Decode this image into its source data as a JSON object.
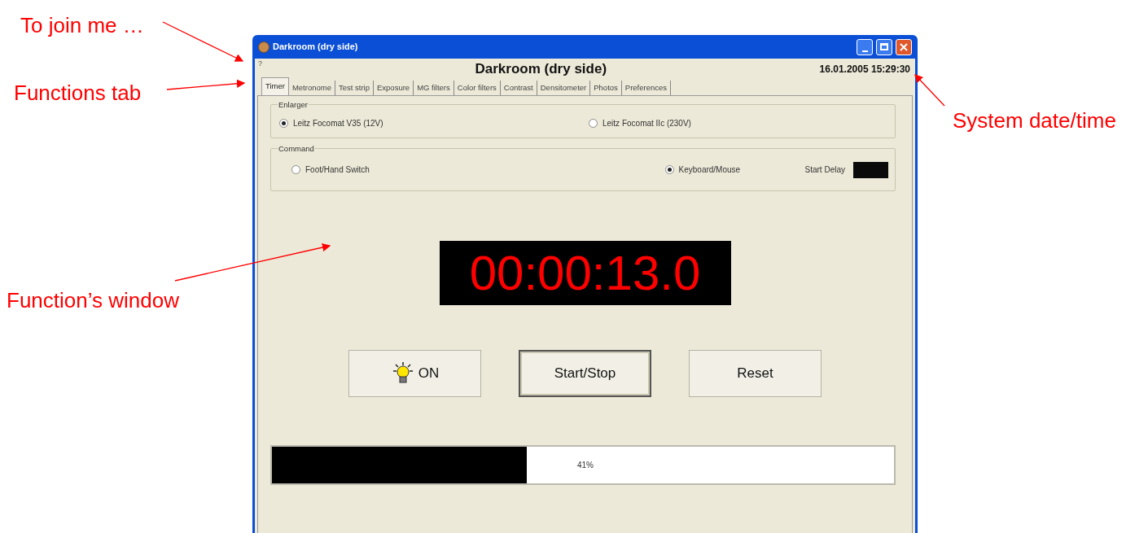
{
  "annotations": [
    "To join me …",
    "Functions tab",
    "Function’s window",
    "System date/time"
  ],
  "window": {
    "title": "Darkroom (dry side)",
    "help": "?",
    "heading": "Darkroom (dry side)",
    "datetime": "16.01.2005 15:29:30"
  },
  "tabs": [
    {
      "label": "Timer",
      "selected": true
    },
    {
      "label": "Metronome",
      "selected": false
    },
    {
      "label": "Test strip",
      "selected": false
    },
    {
      "label": "Exposure",
      "selected": false
    },
    {
      "label": "MG filters",
      "selected": false
    },
    {
      "label": "Color filters",
      "selected": false
    },
    {
      "label": "Contrast",
      "selected": false
    },
    {
      "label": "Densitometer",
      "selected": false
    },
    {
      "label": "Photos",
      "selected": false
    },
    {
      "label": "Preferences",
      "selected": false
    }
  ],
  "enlarger": {
    "label": "Enlarger",
    "options": [
      {
        "label": "Leitz Focomat V35 (12V)",
        "selected": true
      },
      {
        "label": "Leitz Focomat IIc (230V)",
        "selected": false
      }
    ]
  },
  "command": {
    "label": "Command",
    "options": [
      {
        "label": "Foot/Hand Switch",
        "selected": false
      },
      {
        "label": "Keyboard/Mouse",
        "selected": true
      }
    ],
    "start_delay_label": "Start Delay"
  },
  "timer_display": "00:00:13.0",
  "buttons": [
    {
      "kind": "light",
      "label": "ON",
      "focused": false
    },
    {
      "kind": "plain",
      "label": "Start/Stop",
      "focused": true
    },
    {
      "kind": "plain",
      "label": "Reset",
      "focused": false
    }
  ],
  "progress": {
    "level": 0.41,
    "reading": "41%"
  }
}
